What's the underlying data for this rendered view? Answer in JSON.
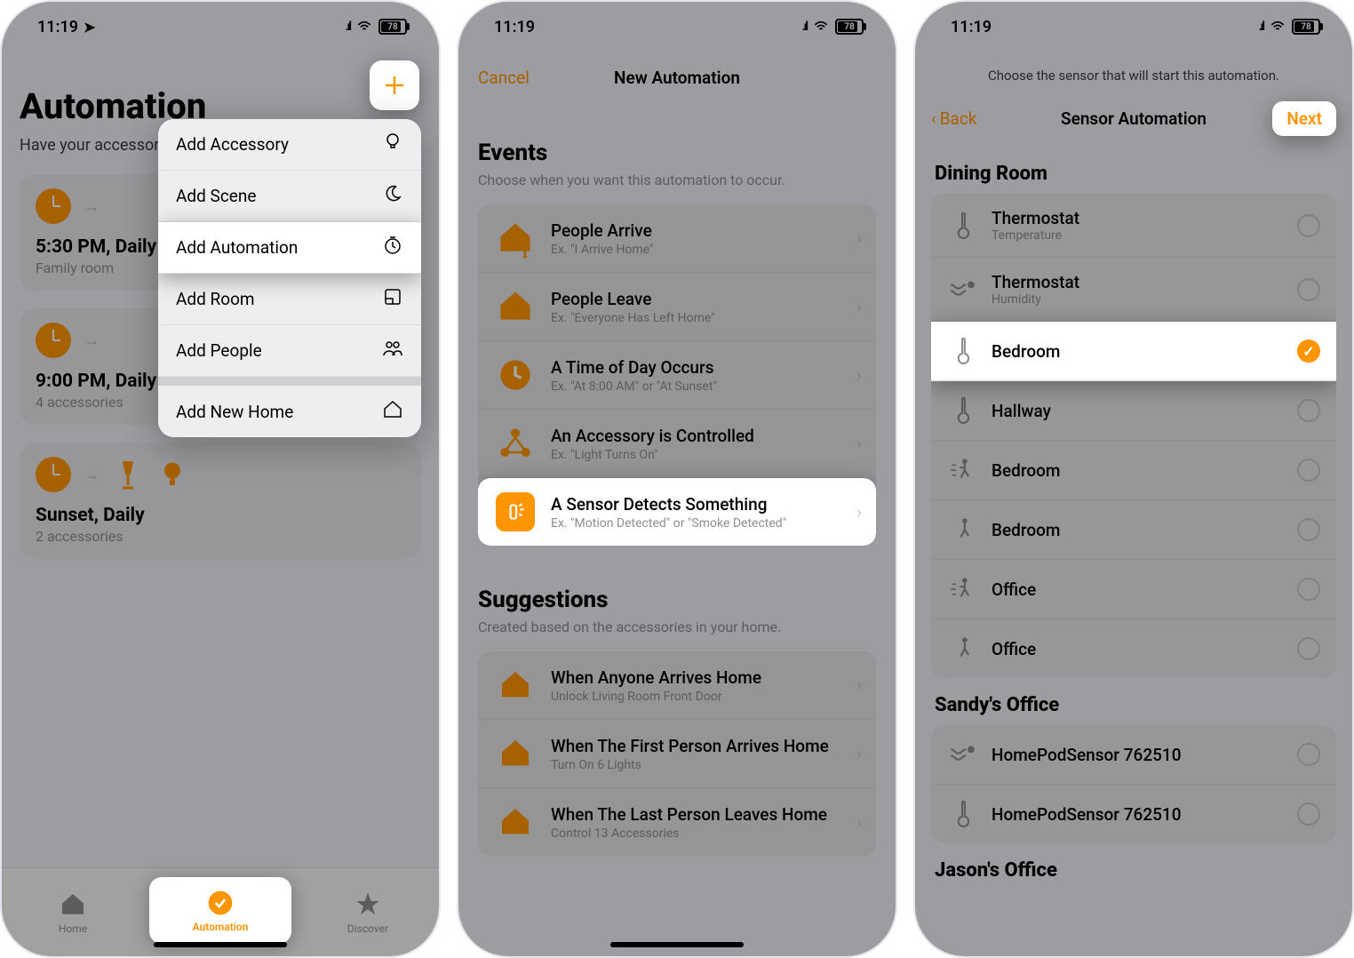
{
  "status": {
    "time": "11:19",
    "battery": "78"
  },
  "screen1": {
    "title": "Automation",
    "subtitle": "Have your accessories react to changes at home.",
    "menu": [
      {
        "label": "Add Accessory",
        "icon": "lightbulb"
      },
      {
        "label": "Add Scene",
        "icon": "moon"
      },
      {
        "label": "Add Automation",
        "icon": "timer",
        "highlight": true
      },
      {
        "label": "Add Room",
        "icon": "room"
      },
      {
        "label": "Add People",
        "icon": "people"
      },
      {
        "label": "Add New Home",
        "icon": "home"
      }
    ],
    "automations": [
      {
        "time": "5:30 PM, Daily",
        "sub": "Family room"
      },
      {
        "time": "9:00 PM, Daily",
        "sub": "4 accessories"
      },
      {
        "time": "Sunset, Daily",
        "sub": "2 accessories",
        "lamps": true
      }
    ],
    "tabs": {
      "home": "Home",
      "automation": "Automation",
      "discover": "Discover"
    }
  },
  "screen2": {
    "cancel": "Cancel",
    "title": "New Automation",
    "events_title": "Events",
    "events_sub": "Choose when you want this automation to occur.",
    "events": [
      {
        "title": "People Arrive",
        "sub": "Ex. \"I Arrive Home\"",
        "icon": "arrive"
      },
      {
        "title": "People Leave",
        "sub": "Ex. \"Everyone Has Left Home\"",
        "icon": "leave"
      },
      {
        "title": "A Time of Day Occurs",
        "sub": "Ex. \"At 8:00 AM\" or \"At Sunset\"",
        "icon": "clock"
      },
      {
        "title": "An Accessory is Controlled",
        "sub": "Ex. \"Light Turns On\"",
        "icon": "accessory"
      },
      {
        "title": "A Sensor Detects Something",
        "sub": "Ex. \"Motion Detected\" or \"Smoke Detected\"",
        "icon": "sensor",
        "highlight": true
      }
    ],
    "suggest_title": "Suggestions",
    "suggest_sub": "Created based on the accessories in your home.",
    "suggestions": [
      {
        "title": "When Anyone Arrives Home",
        "sub": "Unlock Living Room Front Door"
      },
      {
        "title": "When The First Person Arrives Home",
        "sub": "Turn On 6 Lights"
      },
      {
        "title": "When The Last Person Leaves Home",
        "sub": "Control 13 Accessories"
      }
    ]
  },
  "screen3": {
    "hint": "Choose the sensor that will start this automation.",
    "back": "Back",
    "title": "Sensor Automation",
    "next": "Next",
    "sections": [
      {
        "name": "Dining Room",
        "items": [
          {
            "title": "Thermostat",
            "sub": "Temperature",
            "icon": "thermo"
          },
          {
            "title": "Thermostat",
            "sub": "Humidity",
            "icon": "humidity"
          },
          {
            "title": "Bedroom",
            "sub": "",
            "icon": "thermo",
            "highlight": true,
            "selected": true
          },
          {
            "title": "Hallway",
            "sub": "",
            "icon": "thermo"
          },
          {
            "title": "Bedroom",
            "sub": "",
            "icon": "motion"
          },
          {
            "title": "Bedroom",
            "sub": "",
            "icon": "motion-off"
          },
          {
            "title": "Office",
            "sub": "",
            "icon": "motion"
          },
          {
            "title": "Office",
            "sub": "",
            "icon": "motion-off"
          }
        ]
      },
      {
        "name": "Sandy's Office",
        "items": [
          {
            "title": "HomePodSensor 762510",
            "sub": "",
            "icon": "humidity"
          },
          {
            "title": "HomePodSensor 762510",
            "sub": "",
            "icon": "thermo"
          }
        ]
      },
      {
        "name": "Jason's Office",
        "items": []
      }
    ]
  }
}
